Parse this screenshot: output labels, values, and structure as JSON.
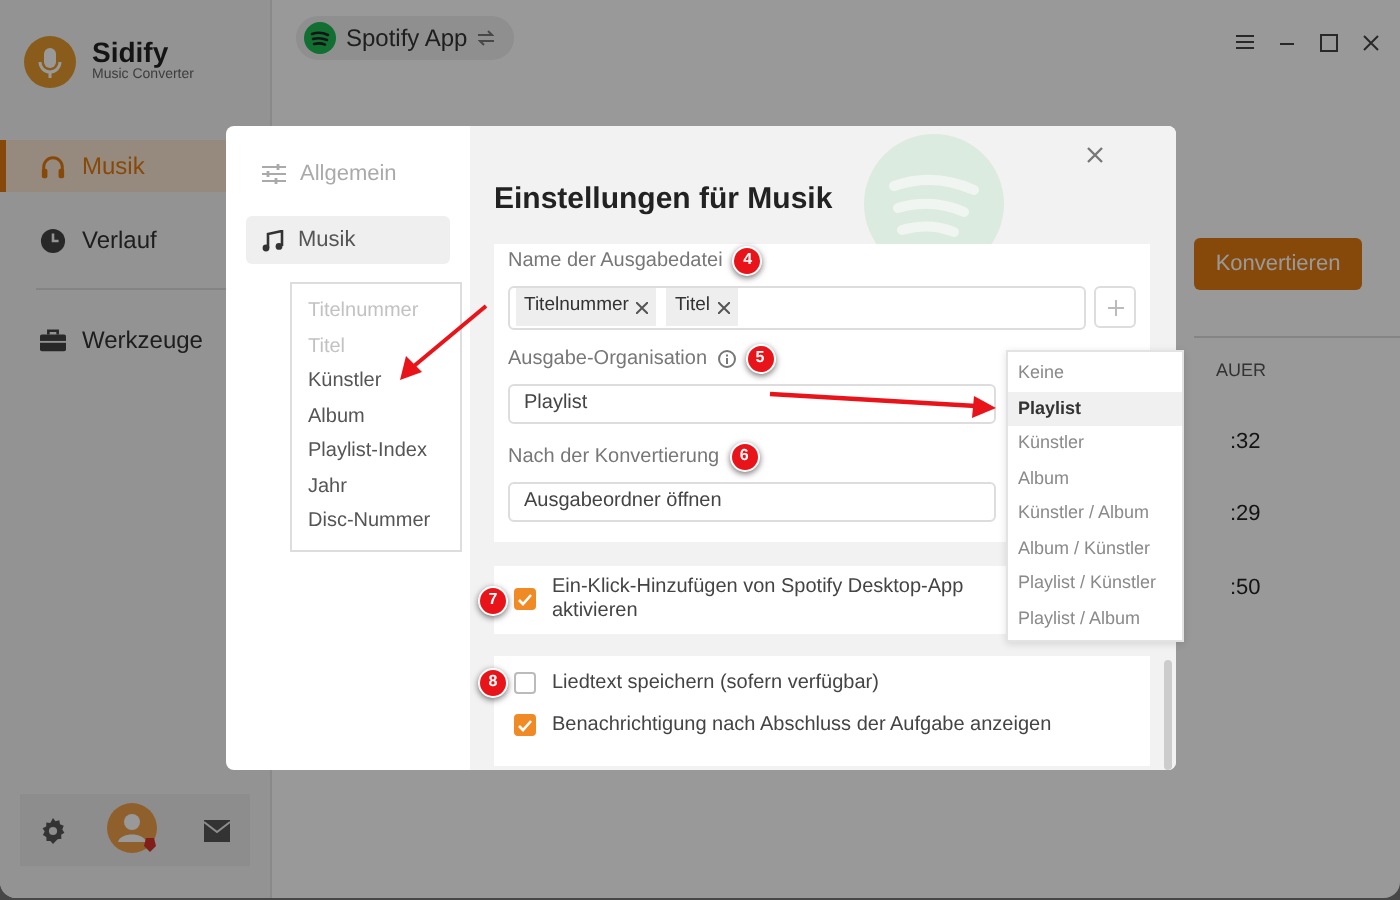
{
  "app": {
    "brand": "Sidify",
    "tagline": "Music Converter",
    "nav_groups": [
      [
        {
          "label": "Musik",
          "selected": true
        },
        {
          "label": "Verlauf",
          "selected": false
        }
      ],
      [
        {
          "label": "Werkzeuge",
          "selected": false
        }
      ]
    ],
    "source": "Spotify App",
    "convert_button": "Konvertieren",
    "column_header": "AUER",
    "durations": [
      ":32",
      ":29",
      ":50"
    ]
  },
  "dialog": {
    "sidebar": [
      {
        "label": "Allgemein",
        "selected": false
      },
      {
        "label": "Musik",
        "selected": true
      }
    ],
    "tag_options": [
      {
        "label": "Titelnummer",
        "disabled": true
      },
      {
        "label": "Titel",
        "disabled": true
      },
      {
        "label": "Künstler",
        "disabled": false
      },
      {
        "label": "Album",
        "disabled": false
      },
      {
        "label": "Playlist-Index",
        "disabled": false
      },
      {
        "label": "Jahr",
        "disabled": false
      },
      {
        "label": "Disc-Nummer",
        "disabled": false
      }
    ],
    "title": "Einstellungen für Musik",
    "filename": {
      "label": "Name der Ausgabedatei",
      "marker": "4",
      "tags": [
        "Titelnummer",
        "Titel"
      ]
    },
    "organisation": {
      "label": "Ausgabe-Organisation",
      "marker": "5",
      "value": "Playlist"
    },
    "after_conversion": {
      "label": "Nach der Konvertierung",
      "marker": "6",
      "value": "Ausgabeordner öffnen"
    },
    "spotify_addon": {
      "label": "Ein-Klick-Hinzufügen von Spotify Desktop-App aktivieren",
      "marker": "7",
      "checked": true
    },
    "options": [
      {
        "label": "Liedtext speichern (sofern verfügbar)",
        "marker": "8",
        "checked": false
      },
      {
        "label": "Benachrichtigung nach Abschluss der Aufgabe anzeigen",
        "checked": true
      }
    ],
    "organisation_menu": [
      {
        "label": "Keine",
        "selected": false
      },
      {
        "label": "Playlist",
        "selected": true
      },
      {
        "label": "Künstler",
        "selected": false
      },
      {
        "label": "Album",
        "selected": false
      },
      {
        "label": "Künstler / Album",
        "selected": false
      },
      {
        "label": "Album / Künstler",
        "selected": false
      },
      {
        "label": "Playlist / Künstler",
        "selected": false
      },
      {
        "label": "Playlist / Album",
        "selected": false
      }
    ]
  }
}
